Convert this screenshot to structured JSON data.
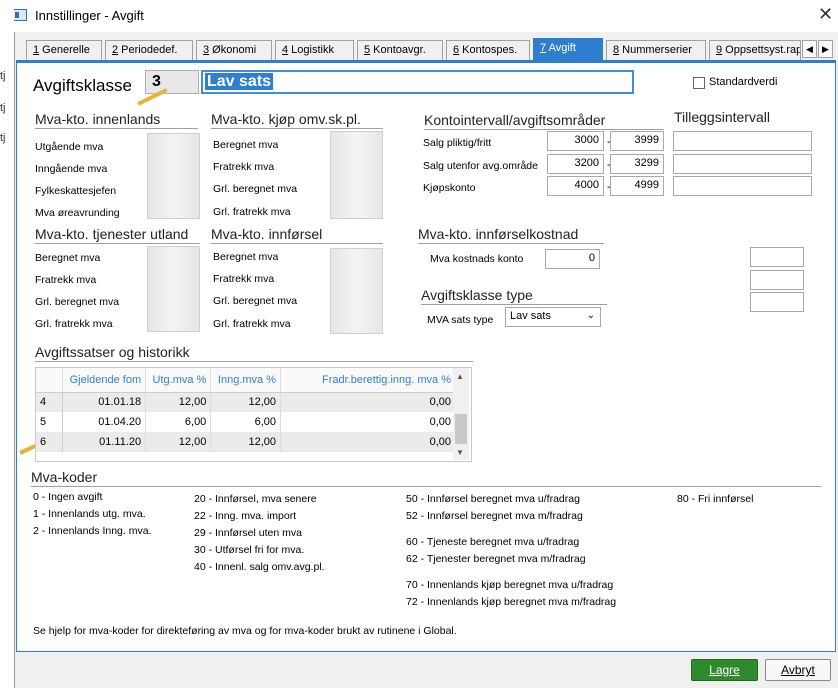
{
  "window": {
    "title": "Innstillinger - Avgift"
  },
  "left_edge": [
    "tj",
    "tj",
    "tj"
  ],
  "tabs": [
    {
      "key": "1",
      "label": " Generelle"
    },
    {
      "key": "2",
      "label": " Periodedef."
    },
    {
      "key": "3",
      "label": " Økonomi"
    },
    {
      "key": "4",
      "label": " Logistikk"
    },
    {
      "key": "5",
      "label": " Kontoavgr."
    },
    {
      "key": "6",
      "label": " Kontospes."
    },
    {
      "key": "7",
      "label": " Avgift"
    },
    {
      "key": "8",
      "label": " Nummerserier"
    },
    {
      "key": "9",
      "label": " Oppsettsyst.rap"
    }
  ],
  "avgiftsklasse": {
    "label": "Avgiftsklasse",
    "id": "3",
    "name": "Lav sats",
    "standard_label": "Standardverdi"
  },
  "innenlands": {
    "title": "Mva-kto. innenlands",
    "fields": [
      "Utgående mva",
      "Inngående mva",
      "Fylkeskattesjefen",
      "Mva øreavrunding"
    ]
  },
  "kjop_omv": {
    "title": "Mva-kto. kjøp omv.sk.pl.",
    "fields": [
      "Beregnet mva",
      "Fratrekk mva",
      "Grl. beregnet mva",
      "Grl. fratrekk mva"
    ]
  },
  "tjenester": {
    "title": "Mva-kto. tjenester utland",
    "fields": [
      "Beregnet mva",
      "Fratrekk mva",
      "Grl. beregnet mva",
      "Grl. fratrekk mva"
    ]
  },
  "innforsel": {
    "title": "Mva-kto. innførsel",
    "fields": [
      "Beregnet mva",
      "Fratrekk mva",
      "Grl. beregnet mva",
      "Grl. fratrekk mva"
    ]
  },
  "kontointervall": {
    "title": "Kontointervall/avgiftsområder",
    "rows": [
      {
        "label": "Salg pliktig/fritt",
        "from": "3000",
        "to": "3999"
      },
      {
        "label": "Salg utenfor avg.område",
        "from": "3200",
        "to": "3299"
      },
      {
        "label": "Kjøpskonto",
        "from": "4000",
        "to": "4999"
      }
    ],
    "sep": "-"
  },
  "tillegg": {
    "title": "Tilleggsintervall"
  },
  "innforselkostnad": {
    "title": "Mva-kto. innførselkostnad",
    "label": "Mva kostnads konto",
    "value": "0"
  },
  "avgiftsklasse_type": {
    "title": "Avgiftsklasse type",
    "label": "MVA sats type",
    "value": "Lav sats"
  },
  "satser": {
    "title": "Avgiftssatser og historikk",
    "columns": [
      "Gjeldende fom",
      "Utg.mva %",
      "Inng.mva %",
      "Fradr.berettig.inng. mva %"
    ],
    "rows": [
      {
        "no": "4",
        "fom": "01.01.18",
        "utg": "12,00",
        "inng": "12,00",
        "fradr": "0,00"
      },
      {
        "no": "5",
        "fom": "01.04.20",
        "utg": "6,00",
        "inng": "6,00",
        "fradr": "0,00"
      },
      {
        "no": "6",
        "fom": "01.11.20",
        "utg": "12,00",
        "inng": "12,00",
        "fradr": "0,00"
      }
    ]
  },
  "mva_koder": {
    "title": "Mva-koder",
    "col1": [
      "0 - Ingen avgift",
      "1 - Innenlands utg. mva.",
      "2 - Innenlands Inng. mva."
    ],
    "col2": [
      "20 - Innførsel, mva senere",
      "22 - Inng. mva. import",
      "29 - Innførsel uten mva",
      "30 - Utførsel fri for mva.",
      "40 - Innenl. salg omv.avg.pl."
    ],
    "col3a": [
      "50 - Innførsel beregnet mva u/fradrag",
      "52 - Innførsel beregnet mva m/fradrag"
    ],
    "col3b": [
      "60 - Tjeneste beregnet mva u/fradrag",
      "62 - Tjenester beregnet mva m/fradrag"
    ],
    "col3c": [
      "70 - Innenlands kjøp beregnet mva u/fradrag",
      "72 - Innenlands kjøp beregnet mva  m/fradrag"
    ],
    "col4": [
      "80 - Fri innførsel"
    ],
    "footer": "Se hjelp for mva-koder for direkteføring av mva og for mva-koder brukt av rutinene i Global."
  },
  "buttons": {
    "save": "Lagre",
    "cancel": "Avbryt"
  },
  "colors": {
    "accent": "#2e7fd0",
    "save": "#2f8a2f",
    "arrow": "#e8b23a"
  }
}
